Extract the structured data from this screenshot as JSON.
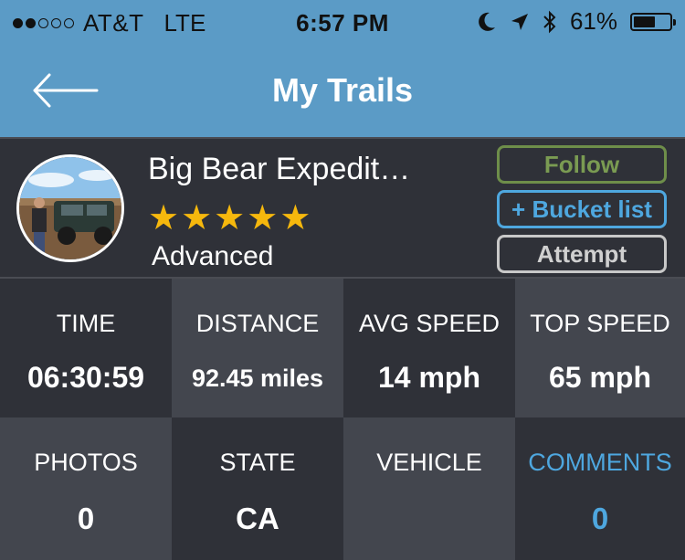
{
  "status_bar": {
    "signal_dots_filled": 2,
    "signal_dots_total": 5,
    "carrier": "AT&T",
    "network": "LTE",
    "time": "6:57 PM",
    "icons": [
      "moon-icon",
      "location-arrow-icon",
      "bluetooth-icon"
    ],
    "battery_percent": "61%",
    "battery_level": 0.61
  },
  "nav": {
    "title": "My Trails",
    "back_icon": "back-arrow-icon"
  },
  "trail": {
    "name": "Big Bear Expedit…",
    "rating_stars": 5,
    "difficulty": "Advanced",
    "avatar_icon": "jeep-photo-avatar"
  },
  "actions": {
    "follow": "Follow",
    "bucket_list": "+ Bucket list",
    "attempt": "Attempt"
  },
  "colors": {
    "header_blue": "#5b9bc6",
    "star_gold": "#f6b80d",
    "follow_green": "#7a9b52",
    "accent_blue": "#4ea7df"
  },
  "stats": [
    {
      "label": "TIME",
      "value": "06:30:59"
    },
    {
      "label": "DISTANCE",
      "value": "92.45 miles"
    },
    {
      "label": "AVG SPEED",
      "value": "14 mph"
    },
    {
      "label": "TOP SPEED",
      "value": "65 mph"
    },
    {
      "label": "PHOTOS",
      "value": "0"
    },
    {
      "label": "STATE",
      "value": "CA"
    },
    {
      "label": "VEHICLE",
      "value": ""
    },
    {
      "label": "COMMENTS",
      "value": "0"
    }
  ]
}
